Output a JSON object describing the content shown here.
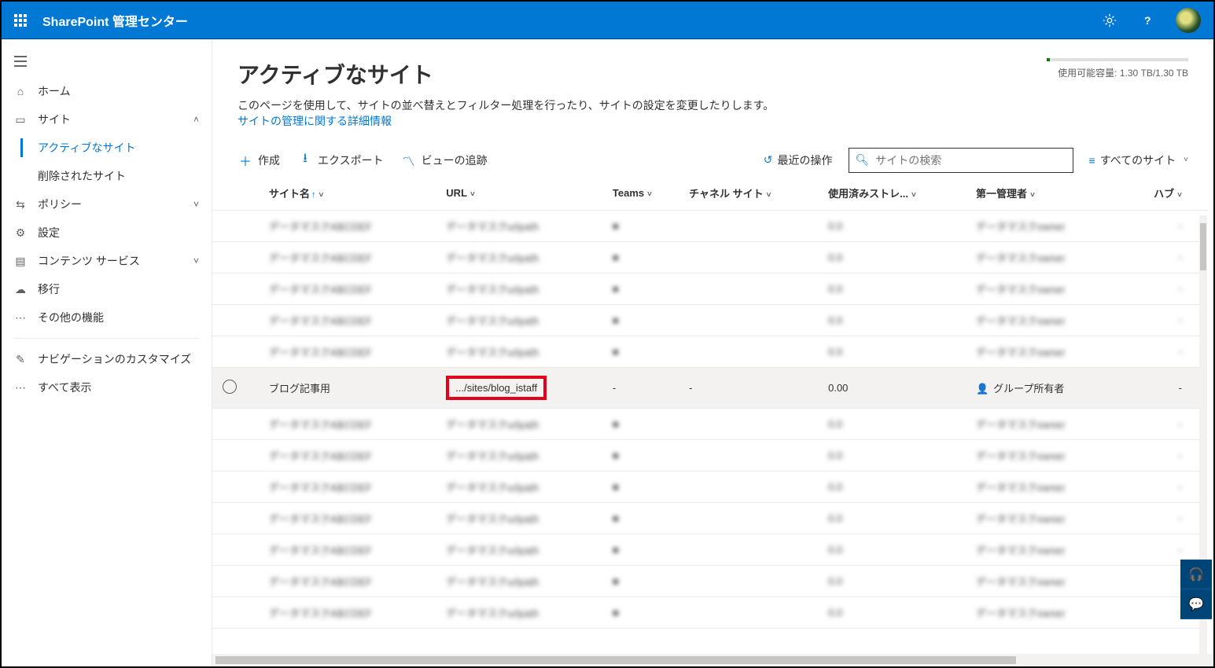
{
  "header": {
    "brand": "SharePoint 管理センター"
  },
  "sidebar": {
    "home": "ホーム",
    "sites": "サイト",
    "active_sites": "アクティブなサイト",
    "deleted_sites": "削除されたサイト",
    "policies": "ポリシー",
    "settings": "設定",
    "content_services": "コンテンツ サービス",
    "migration": "移行",
    "other_features": "その他の機能",
    "custom_nav": "ナビゲーションのカスタマイズ",
    "show_all": "すべて表示"
  },
  "page": {
    "title": "アクティブなサイト",
    "description": "このページを使用して、サイトの並べ替えとフィルター処理を行ったり、サイトの設定を変更したりします。",
    "learn_more": "サイトの管理に関する詳細情報"
  },
  "storage": {
    "label": "使用可能容量: 1.30 TB/1.30 TB"
  },
  "commands": {
    "create": "作成",
    "export": "エクスポート",
    "track": "ビューの追跡",
    "recent": "最近の操作",
    "search_placeholder": "サイトの検索",
    "allsites": "すべてのサイト"
  },
  "columns": {
    "name": "サイト名",
    "url": "URL",
    "teams": "Teams",
    "channel": "チャネル サイト",
    "storage": "使用済みストレ...",
    "admin": "第一管理者",
    "hub": "ハブ"
  },
  "highlight_row": {
    "name": "ブログ記事用",
    "url": ".../sites/blog_istaff",
    "teams": "-",
    "channel": "-",
    "storage": "0.00",
    "admin": "グループ所有者",
    "hub": "-"
  },
  "masked_text": "データマスク"
}
